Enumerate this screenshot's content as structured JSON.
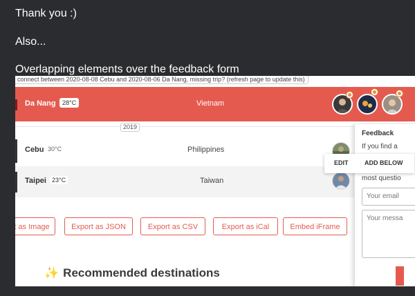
{
  "messages": {
    "line1": "Thank you :)",
    "line2": "Also...",
    "line3": "Overlapping elements over the feedback form"
  },
  "tooltip": "connect between 2020-08-08 Cebu and 2020-08-06 Da Nang, missing trip? (refresh page to update this)",
  "trips": [
    {
      "city": "Da Nang",
      "temp": "28°C",
      "country": "Vietnam"
    },
    {
      "city": "Cebu",
      "temp": "30°C",
      "country": "Philippines"
    },
    {
      "city": "Taipei",
      "temp": "23°C",
      "country": "Taiwan"
    }
  ],
  "year": "2019",
  "export_buttons": [
    "t as Image",
    "Export as JSON",
    "Export as CSV",
    "Export as iCal",
    "Embed iFrame"
  ],
  "recommended": {
    "icon": "sparkles-icon",
    "title": "Recommended destinations"
  },
  "feedback": {
    "title": "Feedback",
    "line1": "If you find a",
    "line2": "most questio",
    "email_placeholder": "Your email",
    "message_placeholder": "Your messa"
  },
  "edit_menu": {
    "edit": "EDIT",
    "add_below": "ADD BELOW"
  },
  "colors": {
    "accent": "#e55a4f",
    "background": "#2b2c2f"
  }
}
